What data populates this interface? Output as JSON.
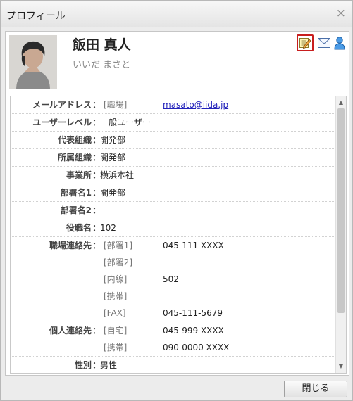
{
  "dialog": {
    "title": "プロフィール",
    "close_glyph": "×",
    "close_button_label": "閉じる"
  },
  "profile": {
    "name": "飯田 真人",
    "kana": "いいだ まさと",
    "actions": [
      "edit-icon",
      "mail-icon",
      "user-icon"
    ]
  },
  "fields": [
    {
      "label": "メールアドレス",
      "tag": "[職場]",
      "value": "masato@iida.jp"
    },
    {
      "label": "ユーザーレベル",
      "value": "一般ユーザー"
    },
    {
      "label": "代表組織",
      "value": "開発部"
    },
    {
      "label": "所属組織",
      "value": "開発部"
    },
    {
      "label": "事業所",
      "value": "横浜本社"
    },
    {
      "label": "部署名1",
      "value": "開発部"
    },
    {
      "label": "部署名2",
      "value": ""
    },
    {
      "label": "役職名",
      "value": "102"
    },
    {
      "label": "職場連絡先",
      "entries": [
        {
          "tag": "[部署1]",
          "value": "045-111-XXXX"
        },
        {
          "tag": "[部署2]",
          "value": ""
        },
        {
          "tag": "[内線]",
          "value": "502"
        },
        {
          "tag": "[携帯]",
          "value": ""
        },
        {
          "tag": "[FAX]",
          "value": "045-111-5679"
        }
      ]
    },
    {
      "label": "個人連絡先",
      "entries": [
        {
          "tag": "[自宅]",
          "value": "045-999-XXXX"
        },
        {
          "tag": "[携帯]",
          "value": "090-0000-XXXX"
        }
      ]
    },
    {
      "label": "性別",
      "value": "男性"
    }
  ],
  "colors": {
    "link": "#2222bb",
    "edit_highlight": "#c81e1e",
    "user_icon": "#2a86d8"
  }
}
